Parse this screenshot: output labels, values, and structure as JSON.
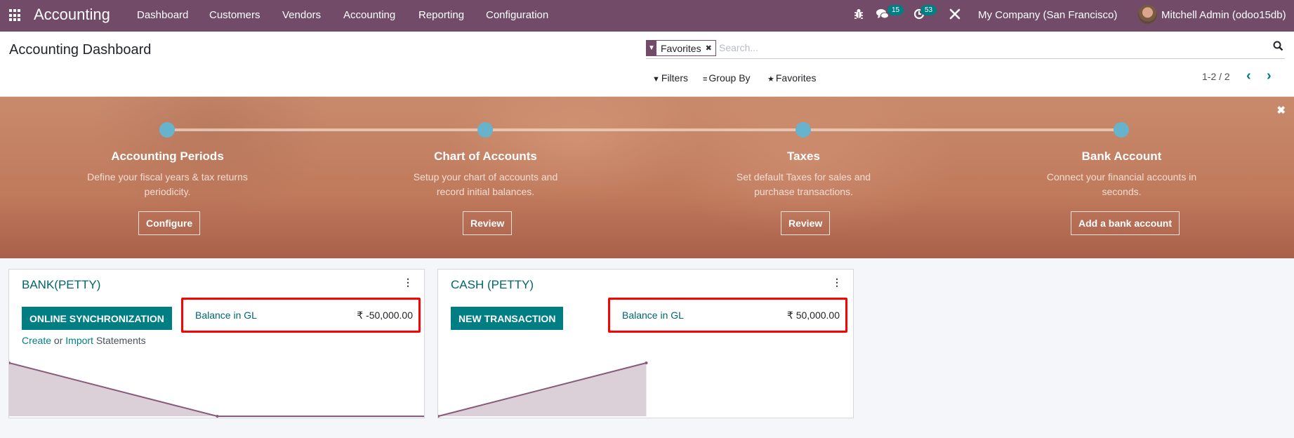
{
  "navbar": {
    "brand": "Accounting",
    "menu": [
      "Dashboard",
      "Customers",
      "Vendors",
      "Accounting",
      "Reporting",
      "Configuration"
    ],
    "messages_count": "15",
    "activities_count": "53",
    "company": "My Company (San Francisco)",
    "user": "Mitchell Admin (odoo15db)"
  },
  "control_panel": {
    "title": "Accounting Dashboard",
    "search": {
      "facet_label": "Favorites",
      "placeholder": "Search...",
      "value": ""
    },
    "filters_label": "Filters",
    "groupby_label": "Group By",
    "favorites_label": "Favorites",
    "pager": "1-2 / 2"
  },
  "onboarding": {
    "steps": [
      {
        "title": "Accounting Periods",
        "description": "Define your fiscal years & tax returns periodicity.",
        "button": "Configure"
      },
      {
        "title": "Chart of Accounts",
        "description": "Setup your chart of accounts and record initial balances.",
        "button": "Review"
      },
      {
        "title": "Taxes",
        "description": "Set default Taxes for sales and purchase transactions.",
        "button": "Review"
      },
      {
        "title": "Bank Account",
        "description": "Connect your financial accounts in seconds.",
        "button": "Add a bank account"
      }
    ]
  },
  "journals": [
    {
      "name": "BANK(PETTY)",
      "primary_action": "ONLINE SYNCHRONIZATION",
      "link_create": "Create",
      "link_or": " or ",
      "link_import": "Import",
      "link_suffix": " Statements",
      "balance_label": "Balance in GL",
      "balance_value": "₹ -50,000.00",
      "graph_points": [
        1,
        0,
        0
      ]
    },
    {
      "name": "CASH (PETTY)",
      "primary_action": "NEW TRANSACTION",
      "balance_label": "Balance in GL",
      "balance_value": "₹ 50,000.00",
      "graph_points": [
        0,
        1
      ]
    }
  ],
  "colors": {
    "brand": "#714b67",
    "accent": "#017e84",
    "highlight": "#ff0000"
  }
}
